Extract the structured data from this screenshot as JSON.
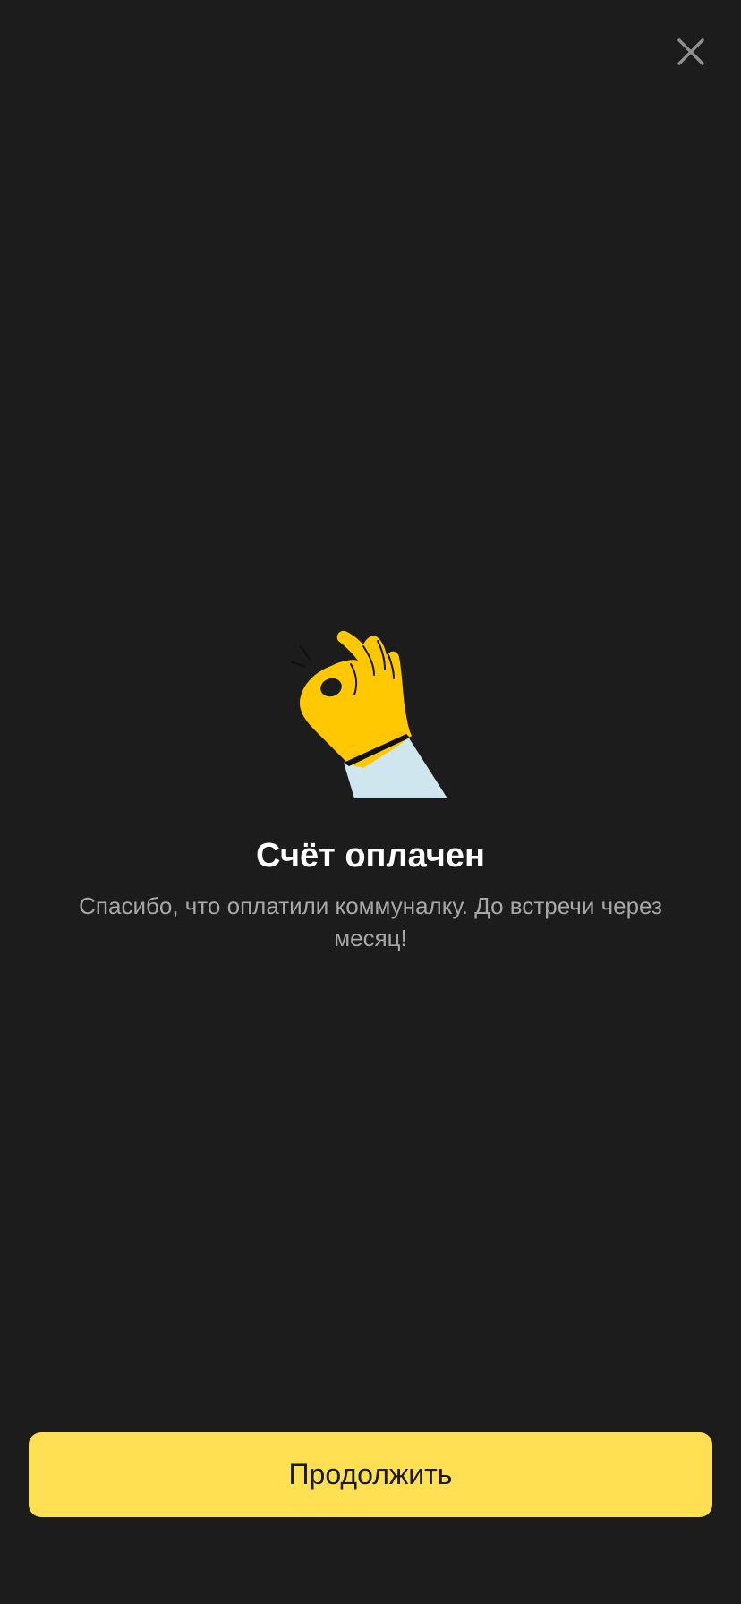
{
  "header": {
    "close_icon": "close-icon"
  },
  "illustration": {
    "icon": "ok-hand-gesture-icon",
    "colors": {
      "hand": "#ffc800",
      "sleeve": "#cfe6ee",
      "outline": "#111111"
    }
  },
  "message": {
    "title": "Счёт оплачен",
    "subtitle": "Спасибо, что оплатили коммуналку. До встречи через месяц!"
  },
  "actions": {
    "continue_label": "Продолжить"
  },
  "colors": {
    "background": "#1c1c1c",
    "accent": "#ffe053",
    "title": "#ffffff",
    "subtitle": "#a7a7a7"
  }
}
